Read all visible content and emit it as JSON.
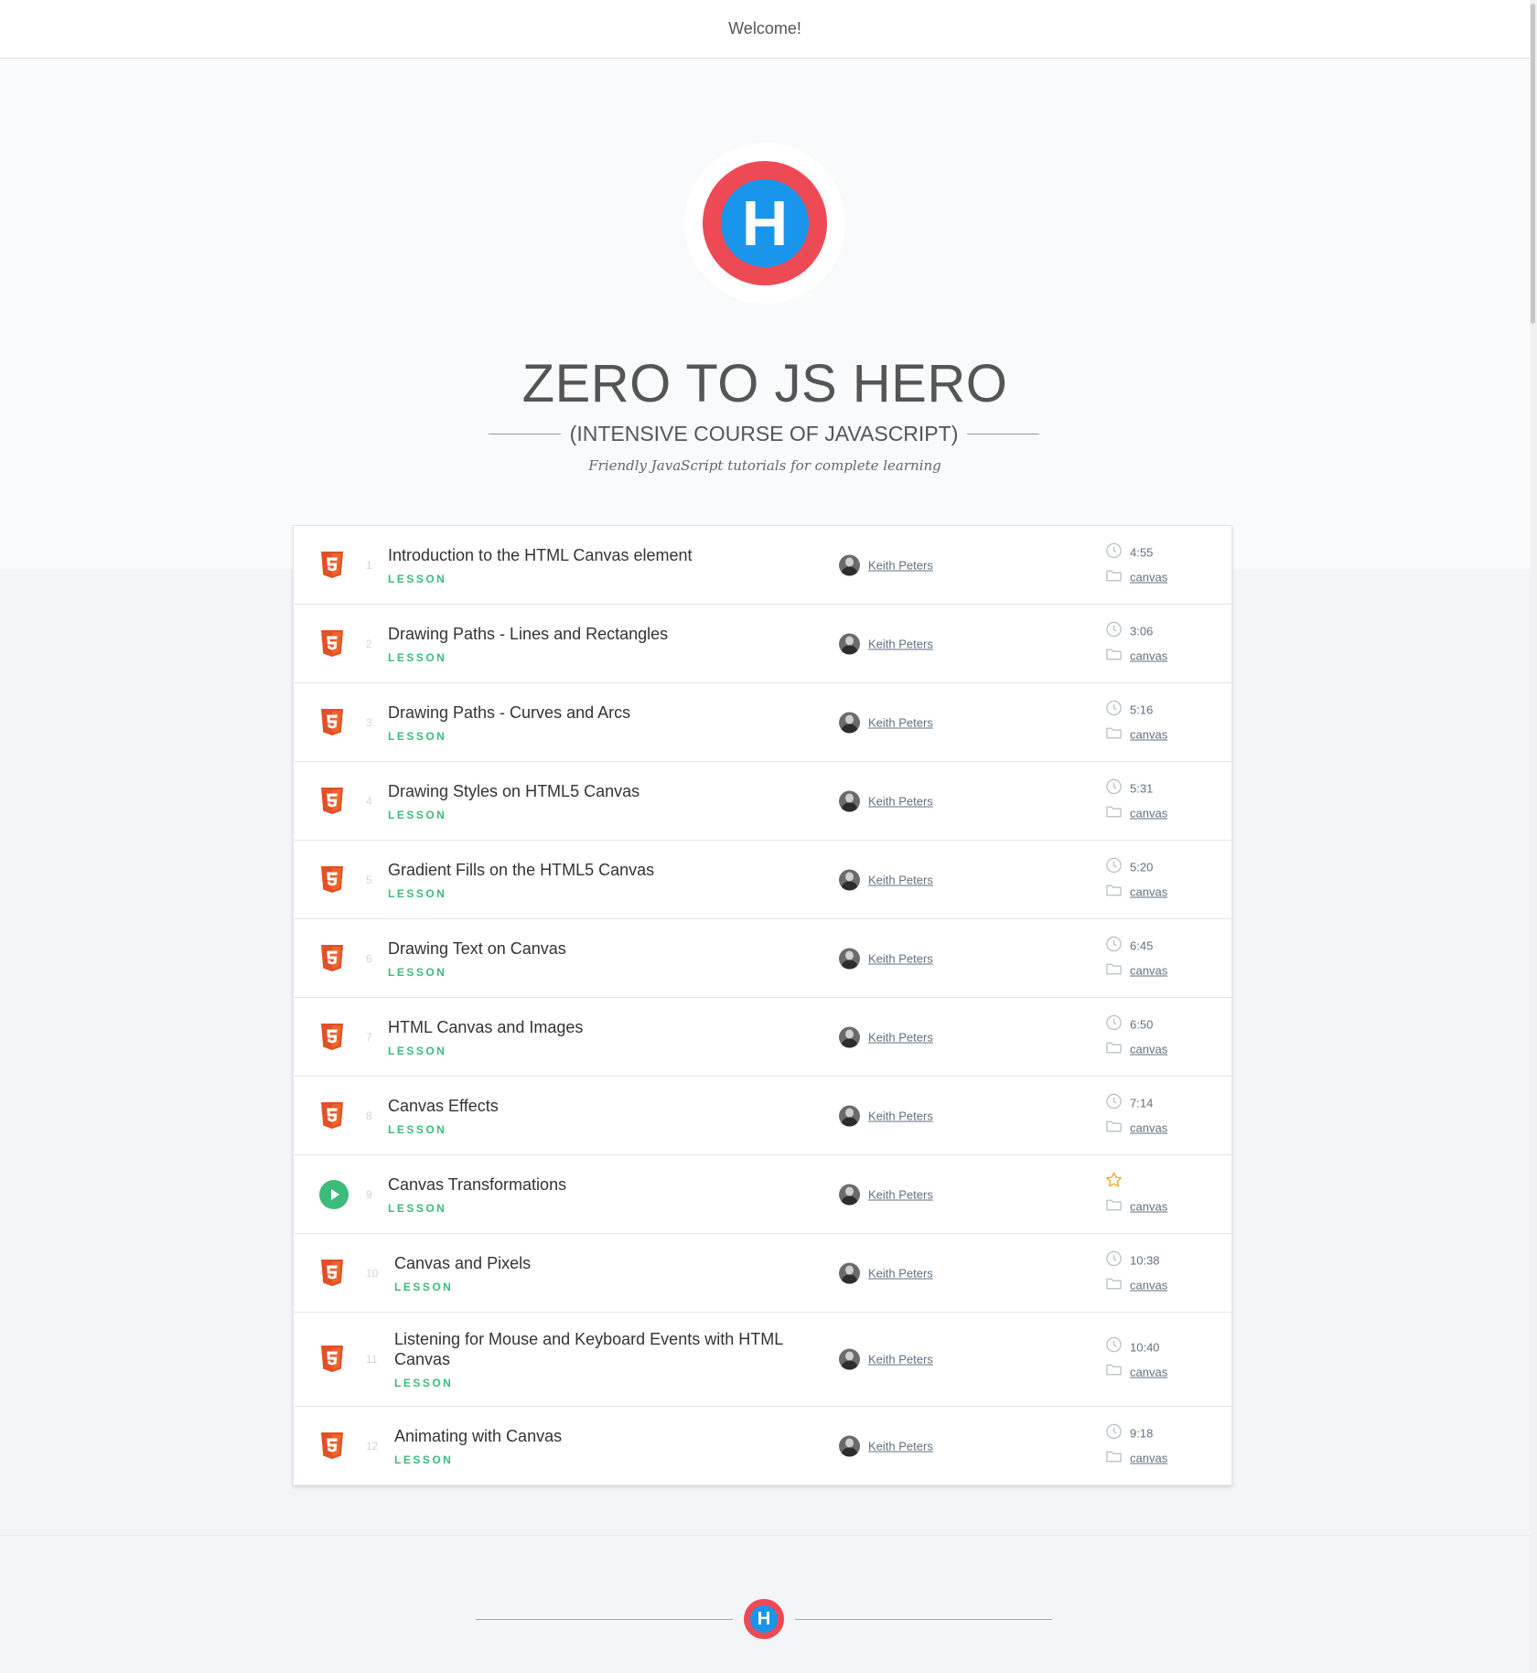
{
  "header": {
    "welcome": "Welcome!"
  },
  "hero": {
    "logo_letter": "H",
    "title": "ZERO TO JS HERO",
    "subtitle": "(INTENSIVE COURSE OF JAVASCRIPT)",
    "tagline": "Friendly JavaScript tutorials for complete learning"
  },
  "colors": {
    "logo_red": "#ee4a55",
    "logo_blue": "#1a95ec",
    "lesson_green": "#3dbb7a",
    "html5_orange": "#e34f26",
    "star": "#f5a623"
  },
  "lessons": [
    {
      "num": "1",
      "title": "Introduction to the HTML Canvas element",
      "kind": "LESSON",
      "author": "Keith Peters",
      "duration": "4:55",
      "tag": "canvas",
      "icon": "html5-icon"
    },
    {
      "num": "2",
      "title": "Drawing Paths - Lines and Rectangles",
      "kind": "LESSON",
      "author": "Keith Peters",
      "duration": "3:06",
      "tag": "canvas",
      "icon": "html5-icon"
    },
    {
      "num": "3",
      "title": "Drawing Paths - Curves and Arcs",
      "kind": "LESSON",
      "author": "Keith Peters",
      "duration": "5:16",
      "tag": "canvas",
      "icon": "html5-icon"
    },
    {
      "num": "4",
      "title": "Drawing Styles on HTML5 Canvas",
      "kind": "LESSON",
      "author": "Keith Peters",
      "duration": "5:31",
      "tag": "canvas",
      "icon": "html5-icon"
    },
    {
      "num": "5",
      "title": "Gradient Fills on the HTML5 Canvas",
      "kind": "LESSON",
      "author": "Keith Peters",
      "duration": "5:20",
      "tag": "canvas",
      "icon": "html5-icon"
    },
    {
      "num": "6",
      "title": "Drawing Text on Canvas",
      "kind": "LESSON",
      "author": "Keith Peters",
      "duration": "6:45",
      "tag": "canvas",
      "icon": "html5-icon"
    },
    {
      "num": "7",
      "title": "HTML Canvas and Images",
      "kind": "LESSON",
      "author": "Keith Peters",
      "duration": "6:50",
      "tag": "canvas",
      "icon": "html5-icon"
    },
    {
      "num": "8",
      "title": "Canvas Effects",
      "kind": "LESSON",
      "author": "Keith Peters",
      "duration": "7:14",
      "tag": "canvas",
      "icon": "html5-icon"
    },
    {
      "num": "9",
      "title": "Canvas Transformations",
      "kind": "LESSON",
      "author": "Keith Peters",
      "duration": "",
      "tag": "canvas",
      "icon": "play-icon",
      "starred": true
    },
    {
      "num": "10",
      "title": "Canvas and Pixels",
      "kind": "LESSON",
      "author": "Keith Peters",
      "duration": "10:38",
      "tag": "canvas",
      "icon": "html5-icon"
    },
    {
      "num": "11",
      "title": "Listening for Mouse and Keyboard Events with HTML Canvas",
      "kind": "LESSON",
      "author": "Keith Peters",
      "duration": "10:40",
      "tag": "canvas",
      "icon": "html5-icon"
    },
    {
      "num": "12",
      "title": "Animating with Canvas",
      "kind": "LESSON",
      "author": "Keith Peters",
      "duration": "9:18",
      "tag": "canvas",
      "icon": "html5-icon"
    }
  ],
  "footer": {
    "logo_letter": "H"
  }
}
